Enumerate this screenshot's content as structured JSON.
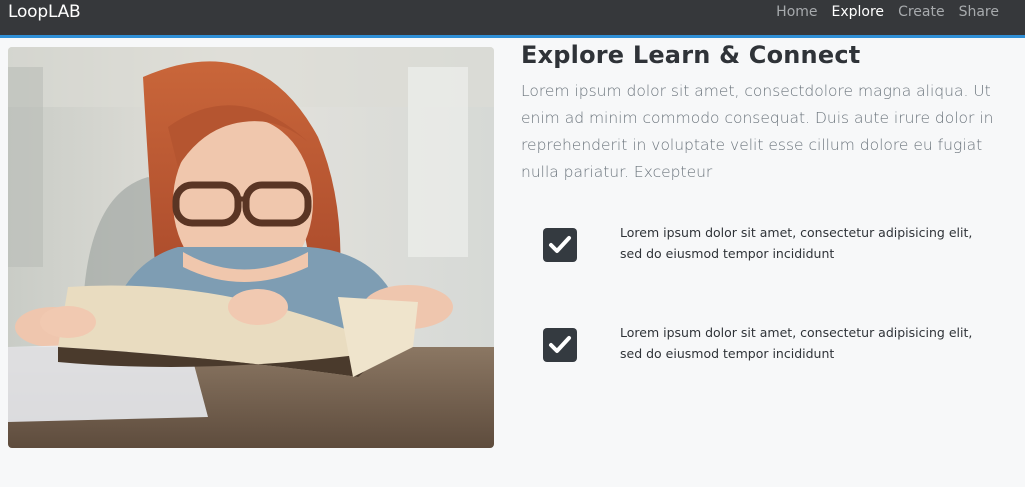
{
  "navbar": {
    "brand": "LoopLAB",
    "links": [
      {
        "label": "Home",
        "active": false
      },
      {
        "label": "Explore",
        "active": true
      },
      {
        "label": "Create",
        "active": false
      },
      {
        "label": "Share",
        "active": false
      }
    ]
  },
  "hero": {
    "image_icon": "photo-girl-reading-book",
    "title": "Explore Learn & Connect",
    "lead": "Lorem ipsum dolor sit amet, consectdolore magna aliqua. Ut enim ad minim commodo consequat. Duis aute irure dolor in reprehenderit in voluptate velit esse cillum dolore eu fugiat nulla pariatur. Excepteur",
    "features": [
      {
        "icon": "check-square-icon",
        "text": "Lorem ipsum dolor sit amet, consectetur adipisicing elit, sed do eiusmod tempor incididunt"
      },
      {
        "icon": "check-square-icon",
        "text": "Lorem ipsum dolor sit amet, consectetur adipisicing elit, sed do eiusmod tempor incididunt"
      }
    ]
  },
  "colors": {
    "navbar_bg": "#36383b",
    "navbar_border": "#2f8fd6",
    "check_bg": "#343a40",
    "page_bg": "#f7f8f9"
  }
}
